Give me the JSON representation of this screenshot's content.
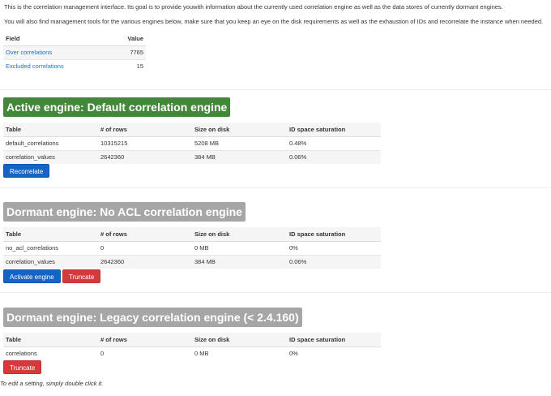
{
  "intro": {
    "line1": "This is the correlation management interface. Its goal is to provide youwith information about the currently used correlation engine as well as the data stores of currently dormant engines.",
    "line2": "You will also find management tools for the various engines below, make sure that you keep an eye on the disk requirements as well as the exhaustion of IDs and recorrelate the instance when needed."
  },
  "summary": {
    "headers": {
      "field": "Field",
      "value": "Value"
    },
    "rows": [
      {
        "field": "Over correlations",
        "value": "7765"
      },
      {
        "field": "Excluded correlations",
        "value": "15"
      }
    ]
  },
  "engine_table_headers": {
    "table": "Table",
    "rows": "# of rows",
    "size": "Size on disk",
    "saturation": "ID space saturation"
  },
  "active": {
    "title": "Active engine: Default correlation engine",
    "rows": [
      {
        "table": "default_correlations",
        "rows": "10315215",
        "size": "5208 MB",
        "saturation": "0.48%"
      },
      {
        "table": "correlation_values",
        "rows": "2642360",
        "size": "384 MB",
        "saturation": "0.06%"
      }
    ],
    "button": "Recorrelate"
  },
  "dormant1": {
    "title": "Dormant engine: No ACL correlation engine",
    "rows": [
      {
        "table": "no_acl_correlations",
        "rows": "0",
        "size": "0 MB",
        "saturation": "0%"
      },
      {
        "table": "correlation_values",
        "rows": "2642360",
        "size": "384 MB",
        "saturation": "0.06%"
      }
    ],
    "activate_button": "Activate engine",
    "truncate_button": "Truncate"
  },
  "dormant2": {
    "title": "Dormant engine: Legacy correlation engine (< 2.4.160)",
    "rows": [
      {
        "table": "correlations",
        "rows": "0",
        "size": "0 MB",
        "saturation": "0%"
      }
    ],
    "truncate_button": "Truncate"
  },
  "footnote": "To edit a setting, simply double click it.",
  "colors": {
    "active_banner": "#43883a",
    "dormant_banner": "#a6a6a6",
    "primary_button": "#1364c4",
    "danger_button": "#d53a3a",
    "link": "#1a73c8"
  }
}
